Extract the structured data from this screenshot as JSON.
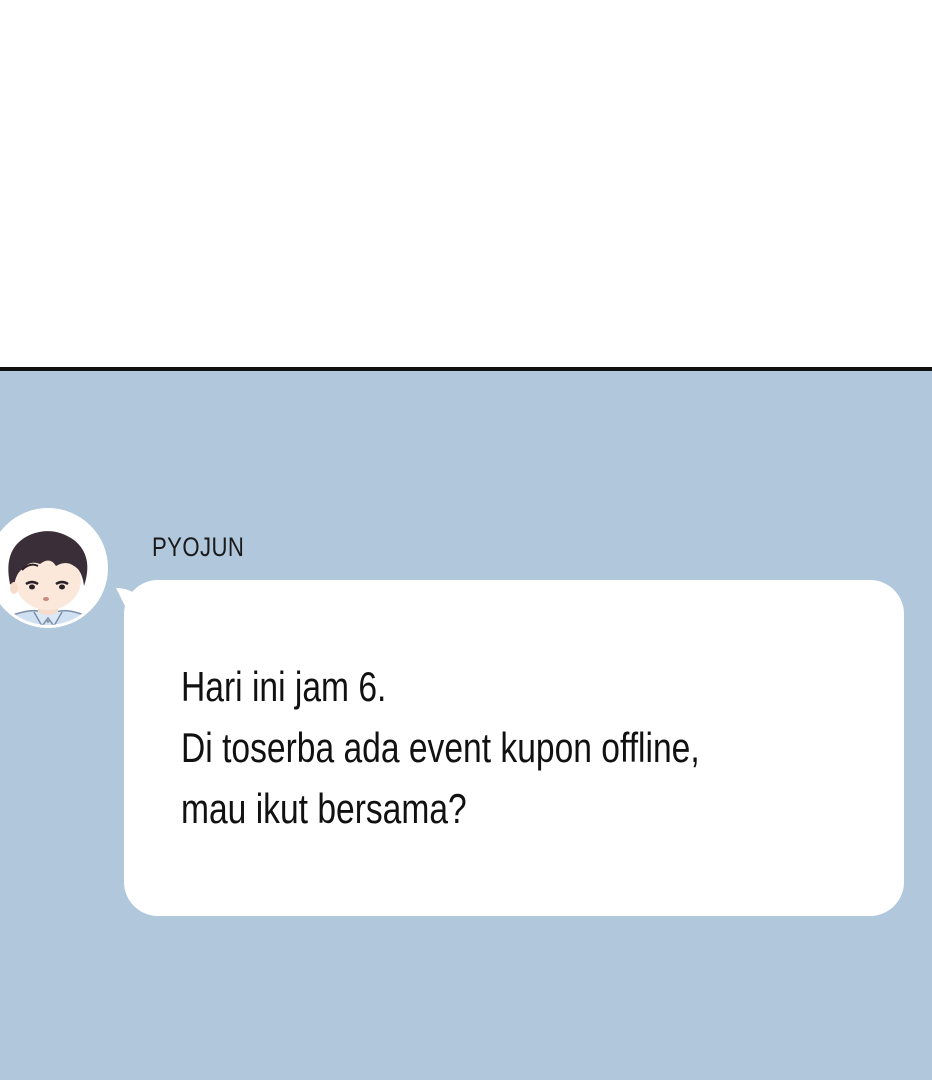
{
  "chat": {
    "sender": {
      "name": "PYOJUN",
      "avatar_icon": "boy-avatar-icon"
    },
    "message": {
      "lines": [
        "Hari ini jam 6.",
        "Di toserba ada event kupon offline,",
        "mau ikut bersama?"
      ]
    },
    "colors": {
      "panel_background": "#b1c7dc",
      "bubble": "#ffffff",
      "divider": "#111111"
    }
  }
}
